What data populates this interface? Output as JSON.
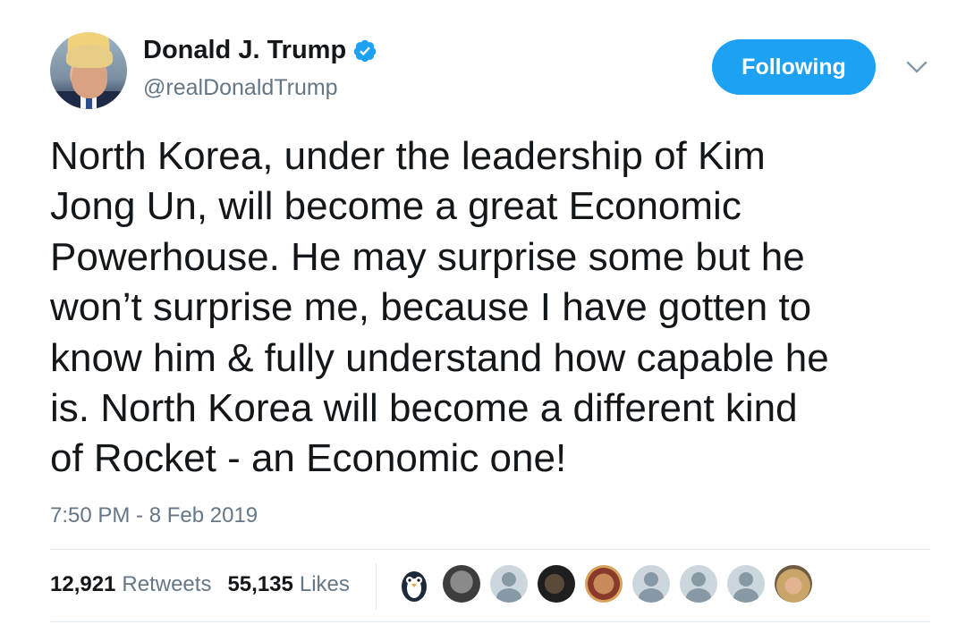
{
  "user": {
    "name": "Donald J. Trump",
    "handle": "@realDonaldTrump",
    "verified": true,
    "avatar": "profile-photo"
  },
  "follow_button": {
    "label": "Following",
    "color": "#1da1f2"
  },
  "menu": {
    "icon": "chevron-down-icon"
  },
  "tweet": {
    "text": "North Korea, under the leadership of Kim\nJong Un, will become a great Economic\nPowerhouse. He may surprise some but he\nwon’t surprise me, because I have gotten to\nknow him & fully understand how capable he\nis. North Korea will become a different kind\nof Rocket - an Economic one!",
    "timestamp": "7:50 PM - 8 Feb 2019"
  },
  "stats": {
    "retweets_count": "12,921",
    "retweets_label": "Retweets",
    "likes_count": "55,135",
    "likes_label": "Likes"
  },
  "likers": [
    {
      "kind": "penguin-avatar"
    },
    {
      "kind": "photo-avatar"
    },
    {
      "kind": "default-avatar"
    },
    {
      "kind": "photo-avatar"
    },
    {
      "kind": "photo-avatar"
    },
    {
      "kind": "default-avatar"
    },
    {
      "kind": "default-avatar"
    },
    {
      "kind": "default-avatar"
    },
    {
      "kind": "photo-avatar"
    }
  ],
  "colors": {
    "text_primary": "#14171a",
    "text_secondary": "#657786",
    "accent": "#1da1f2",
    "divider": "#e1e8ed"
  }
}
